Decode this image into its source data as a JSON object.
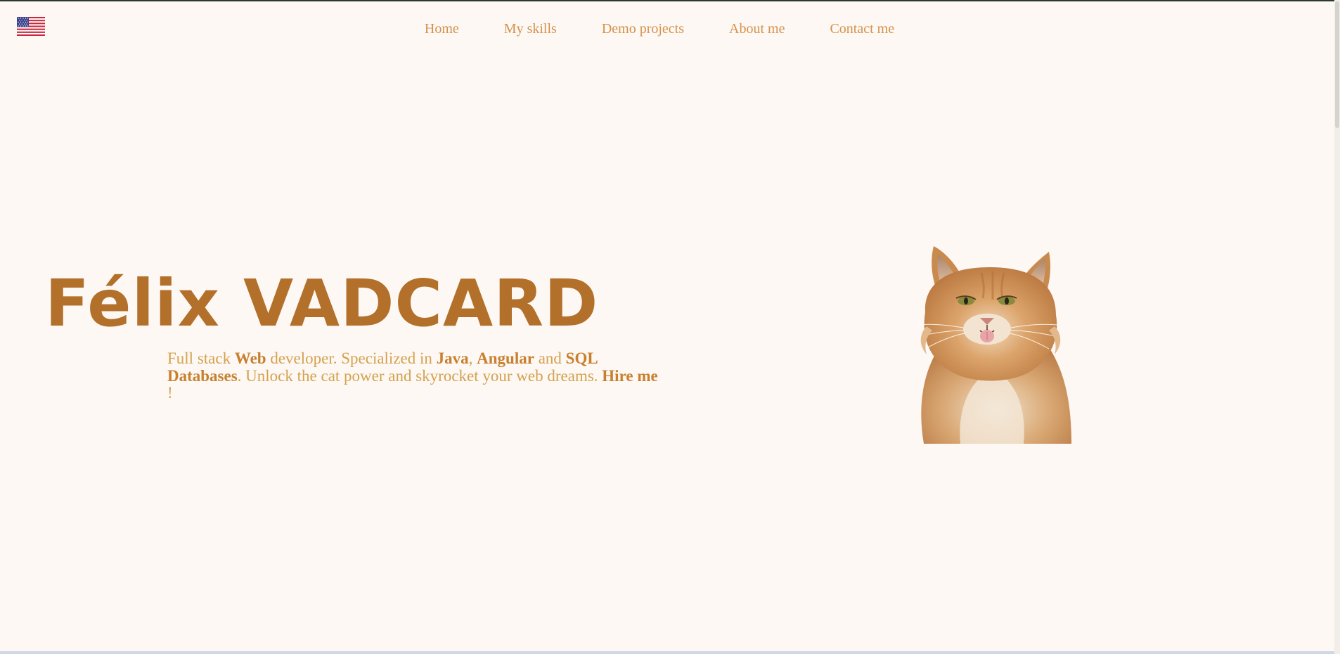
{
  "header": {
    "language_flag": "us-flag-icon",
    "nav": [
      {
        "label": "Home"
      },
      {
        "label": "My skills"
      },
      {
        "label": "Demo projects"
      },
      {
        "label": "About me"
      },
      {
        "label": "Contact me"
      }
    ]
  },
  "hero": {
    "title": "Félix VADCARD",
    "desc": {
      "t1": "Full stack ",
      "b1": "Web",
      "t2": " developer. Specialized in ",
      "b2": "Java",
      "t3": ", ",
      "b3": "Angular",
      "t4": " and ",
      "b4": "SQL Databases",
      "t5": ". Unlock the cat power and skyrocket your web dreams. ",
      "b5": "Hire me",
      "t6": " !"
    },
    "image": "orange-cat-photo"
  },
  "colors": {
    "background": "#fdf8f4",
    "nav_text": "#d4924a",
    "title": "#b2702a",
    "desc_text": "#d4a24e",
    "desc_bold": "#c8802e"
  }
}
